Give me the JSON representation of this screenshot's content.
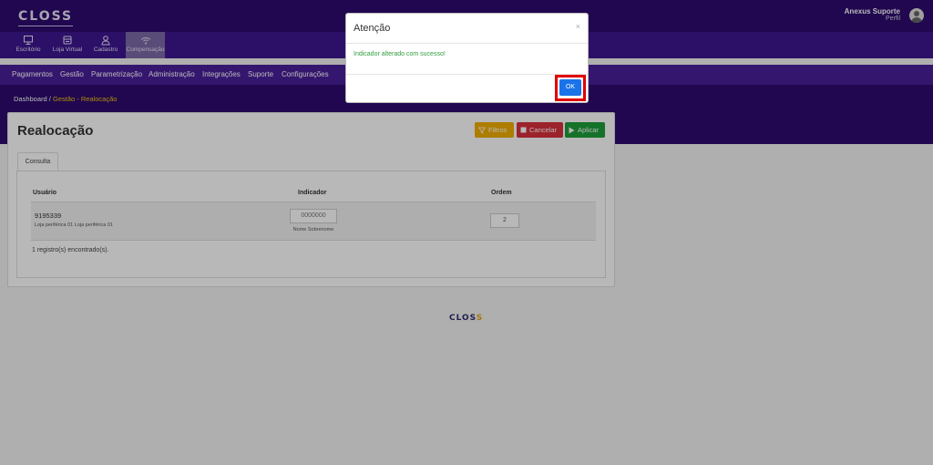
{
  "app": {
    "logo": "CLOSS",
    "user_name": "Anexus Suporte",
    "user_link": "Perfil"
  },
  "modules": [
    {
      "label": "Escritório",
      "icon": "monitor-icon"
    },
    {
      "label": "Loja Virtual",
      "icon": "store-icon"
    },
    {
      "label": "Cadastro",
      "icon": "user-icon"
    },
    {
      "label": "Compensação",
      "icon": "compensation-icon",
      "active": true
    }
  ],
  "menu": [
    "Pagamentos",
    "Gestão",
    "Parametrização",
    "Administração",
    "Integrações",
    "Suporte",
    "Configurações"
  ],
  "breadcrumb": {
    "home": "Dashboard",
    "separator": "/",
    "current": "Gestão - Realocação"
  },
  "page": {
    "title": "Realocação",
    "buttons": {
      "filter": "Filtros",
      "cancel": "Cancelar",
      "apply": "Aplicar"
    },
    "tab": "Consulta",
    "table": {
      "headers": [
        "Usuário",
        "Indicador",
        "Ordem"
      ],
      "rows": [
        {
          "user_id": "9195339",
          "store": "Loja periférica 01 Loja periférica 01",
          "indicator": "0000000",
          "indicator_name": "Nome Sobrenome",
          "order": "2"
        }
      ]
    },
    "records_text": "1 registro(s) encontrado(s)."
  },
  "footer": {
    "logo_main": "CLOS",
    "logo_accent": "S"
  },
  "modal": {
    "title": "Atenção",
    "close": "×",
    "message": "Indicador alterado com sucesso!",
    "ok": "OK"
  },
  "colors": {
    "primary_dark": "#2d0a6e",
    "menu_bg": "#4a1f9a",
    "success": "#2e9e3f",
    "ok_button": "#1a73e8",
    "highlight": "#e00000"
  }
}
